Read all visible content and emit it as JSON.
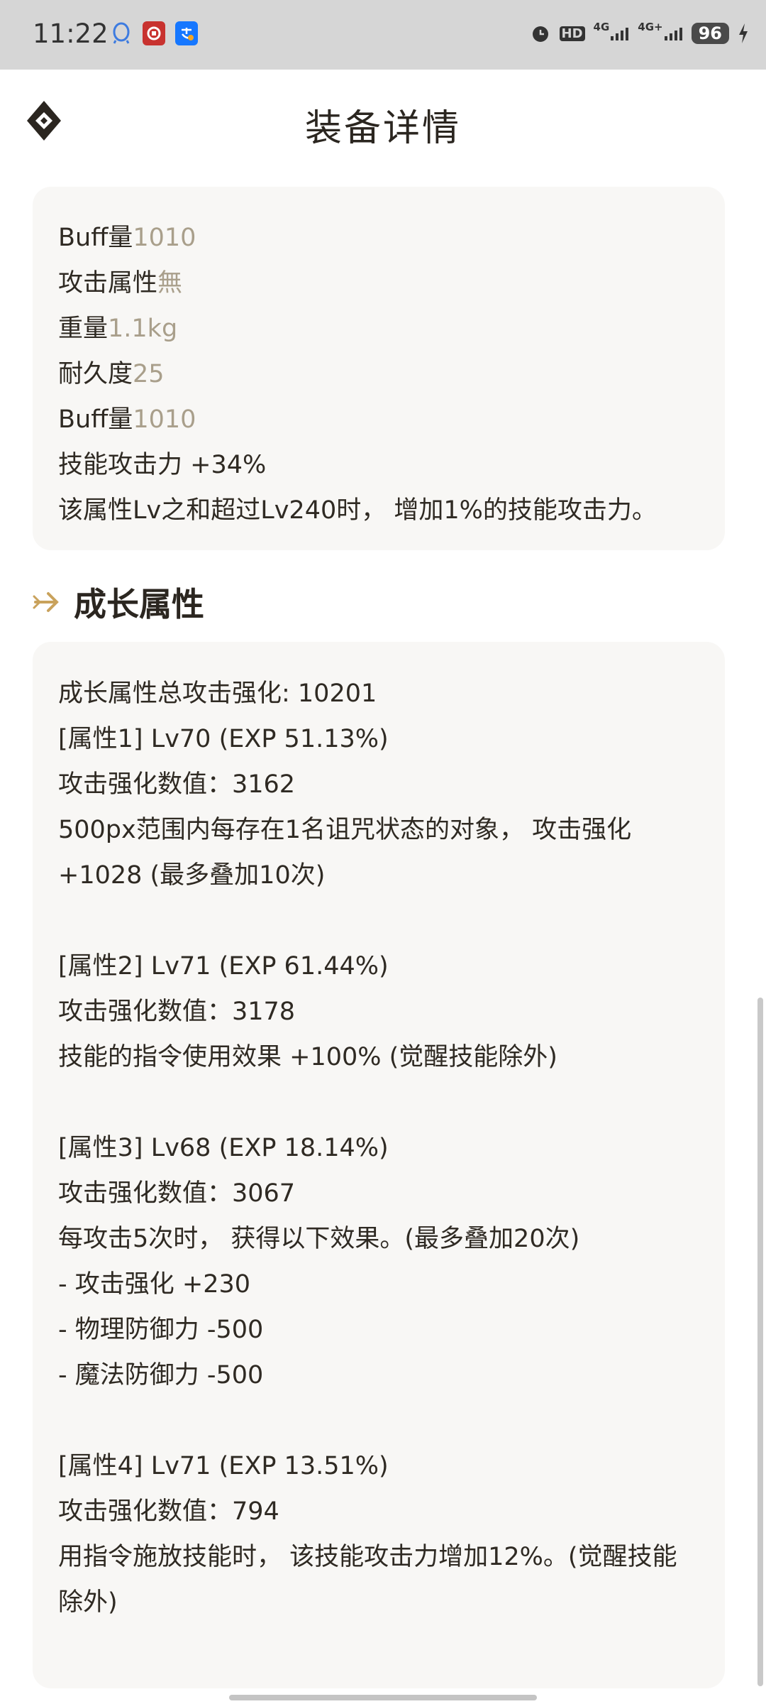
{
  "status_bar": {
    "time": "11:22",
    "network_1": "4G",
    "network_2": "4G+",
    "battery": "96",
    "hd_label": "HD"
  },
  "header": {
    "title": "装备详情"
  },
  "basic_attrs": [
    {
      "label": "Buff量",
      "value": "1010"
    },
    {
      "label": "攻击属性",
      "value": "無"
    },
    {
      "label": "重量",
      "value": "1.1kg"
    },
    {
      "label": "耐久度",
      "value": "25"
    },
    {
      "label": "Buff量",
      "value": "1010"
    },
    {
      "label": "技能攻击力 +34%",
      "value": ""
    },
    {
      "label": "该属性Lv之和超过Lv240时， 增加1%的技能攻击力。",
      "value": ""
    }
  ],
  "growth_section": {
    "title": "成长属性",
    "total": "成长属性总攻击强化: 10201",
    "attr1": {
      "head": "[属性1] Lv70 (EXP 51.13%)",
      "value": "攻击强化数值：3162",
      "desc1": "500px范围内每存在1名诅咒状态的对象， 攻击强化",
      "desc2": "+1028 (最多叠加10次)"
    },
    "attr2": {
      "head": "[属性2] Lv71 (EXP 61.44%)",
      "value": "攻击强化数值：3178",
      "desc1": "技能的指令使用效果 +100% (觉醒技能除外)"
    },
    "attr3": {
      "head": "[属性3] Lv68 (EXP 18.14%)",
      "value": "攻击强化数值：3067",
      "desc1": "每攻击5次时， 获得以下效果。(最多叠加20次)",
      "desc2": "- 攻击强化 +230",
      "desc3": "- 物理防御力 -500",
      "desc4": "- 魔法防御力 -500"
    },
    "attr4": {
      "head": "[属性4] Lv71 (EXP 13.51%)",
      "value": "攻击强化数值：794",
      "desc1": "用指令施放技能时， 该技能攻击力增加12%。(觉醒技能",
      "desc2": "除外)"
    }
  },
  "colors": {
    "value_text": "#a99f8b",
    "card_bg": "#f8f7f5",
    "accent_arrow": "#c9a25c"
  }
}
